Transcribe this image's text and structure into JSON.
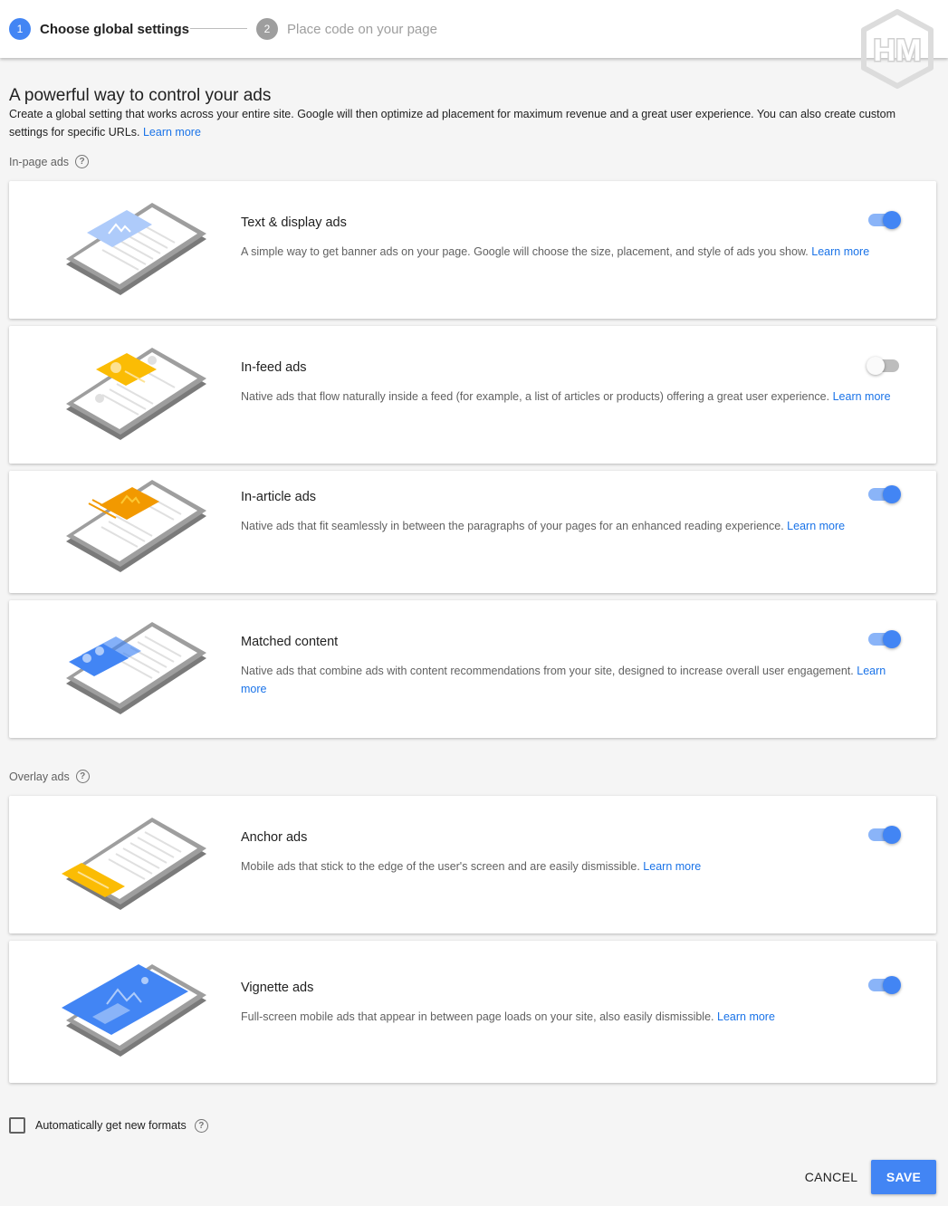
{
  "stepper": {
    "steps": [
      {
        "number": "1",
        "label": "Choose global settings",
        "state": "active"
      },
      {
        "number": "2",
        "label": "Place code on your page",
        "state": "inactive"
      }
    ]
  },
  "logo": {
    "text": "HM"
  },
  "header": {
    "title": "A powerful way to control your ads",
    "intro": "Create a global setting that works across your entire site. Google will then optimize ad placement for maximum revenue and a great user experience. You can also create custom settings for specific URLs.",
    "intro_link": "Learn more"
  },
  "in_page": {
    "label": "In-page ads",
    "help_icon": "?",
    "cards": [
      {
        "title": "Text & display ads",
        "description": "A simple way to get banner ads on your page. Google will choose the size, placement, and style of ads you show.",
        "link": "Learn more",
        "enabled": true,
        "accent": "#aecbfa"
      },
      {
        "title": "In-feed ads",
        "description": "Native ads that flow naturally inside a feed (for example, a list of articles or products) offering a great user experience.",
        "link": "Learn more",
        "enabled": false,
        "accent": "#fbbc04"
      },
      {
        "title": "In-article ads",
        "description": "Native ads that fit seamlessly in between the paragraphs of your pages for an enhanced reading experience.",
        "link": "Learn more",
        "enabled": true,
        "accent": "#f29900"
      },
      {
        "title": "Matched content",
        "description": "Native ads that combine ads with content recommendations from your site, designed to increase overall user engagement.",
        "link": "Learn more",
        "enabled": true,
        "accent": "#4285f4"
      }
    ]
  },
  "overlay": {
    "label": "Overlay ads",
    "help_icon": "?",
    "cards": [
      {
        "title": "Anchor ads",
        "description": "Mobile ads that stick to the edge of the user's screen and are easily dismissible.",
        "link": "Learn more",
        "enabled": true,
        "accent": "#fbbc04"
      },
      {
        "title": "Vignette ads",
        "description": "Full-screen mobile ads that appear in between page loads on your site, also easily dismissible.",
        "link": "Learn more",
        "enabled": true,
        "accent": "#4285f4"
      }
    ]
  },
  "auto_formats": {
    "label": "Automatically get new formats",
    "checked": false,
    "help_icon": "?"
  },
  "actions": {
    "cancel": "CANCEL",
    "save": "SAVE"
  },
  "colors": {
    "primary": "#4285f4",
    "toggle_track_on": "#8ab4f8",
    "link": "#1a73e8",
    "background": "#f5f5f5"
  }
}
